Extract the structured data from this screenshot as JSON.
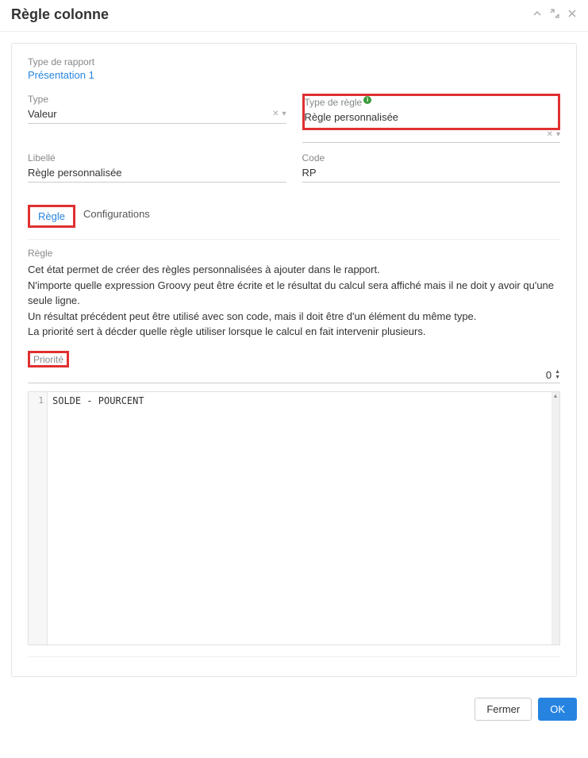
{
  "title": "Règle colonne",
  "report_type": {
    "label": "Type de rapport",
    "link_text": "Présentation 1"
  },
  "fields": {
    "type": {
      "label": "Type",
      "value": "Valeur"
    },
    "rule_type": {
      "label": "Type de règle",
      "value": "Règle personnalisée"
    },
    "libelle": {
      "label": "Libellé",
      "value": "Règle personnalisée"
    },
    "code": {
      "label": "Code",
      "value": "RP"
    }
  },
  "tabs": {
    "rule": "Règle",
    "configs": "Configurations"
  },
  "rule_section": {
    "label": "Règle",
    "p1": "Cet état permet de créer des règles personnalisées à ajouter dans le rapport.",
    "p2": "N'importe quelle expression Groovy peut être écrite et le résultat du calcul sera affiché mais il ne doit y avoir qu'une seule ligne.",
    "p3": "Un résultat précédent peut être utilisé avec son code, mais il doit être d'un élément du même type.",
    "p4": "La priorité sert à décder quelle règle utiliser lorsque le calcul en fait intervenir plusieurs."
  },
  "priority": {
    "label": "Priorité",
    "value": "0"
  },
  "code_editor": {
    "line_number": "1",
    "content": "SOLDE - POURCENT"
  },
  "footer": {
    "close": "Fermer",
    "ok": "OK"
  }
}
